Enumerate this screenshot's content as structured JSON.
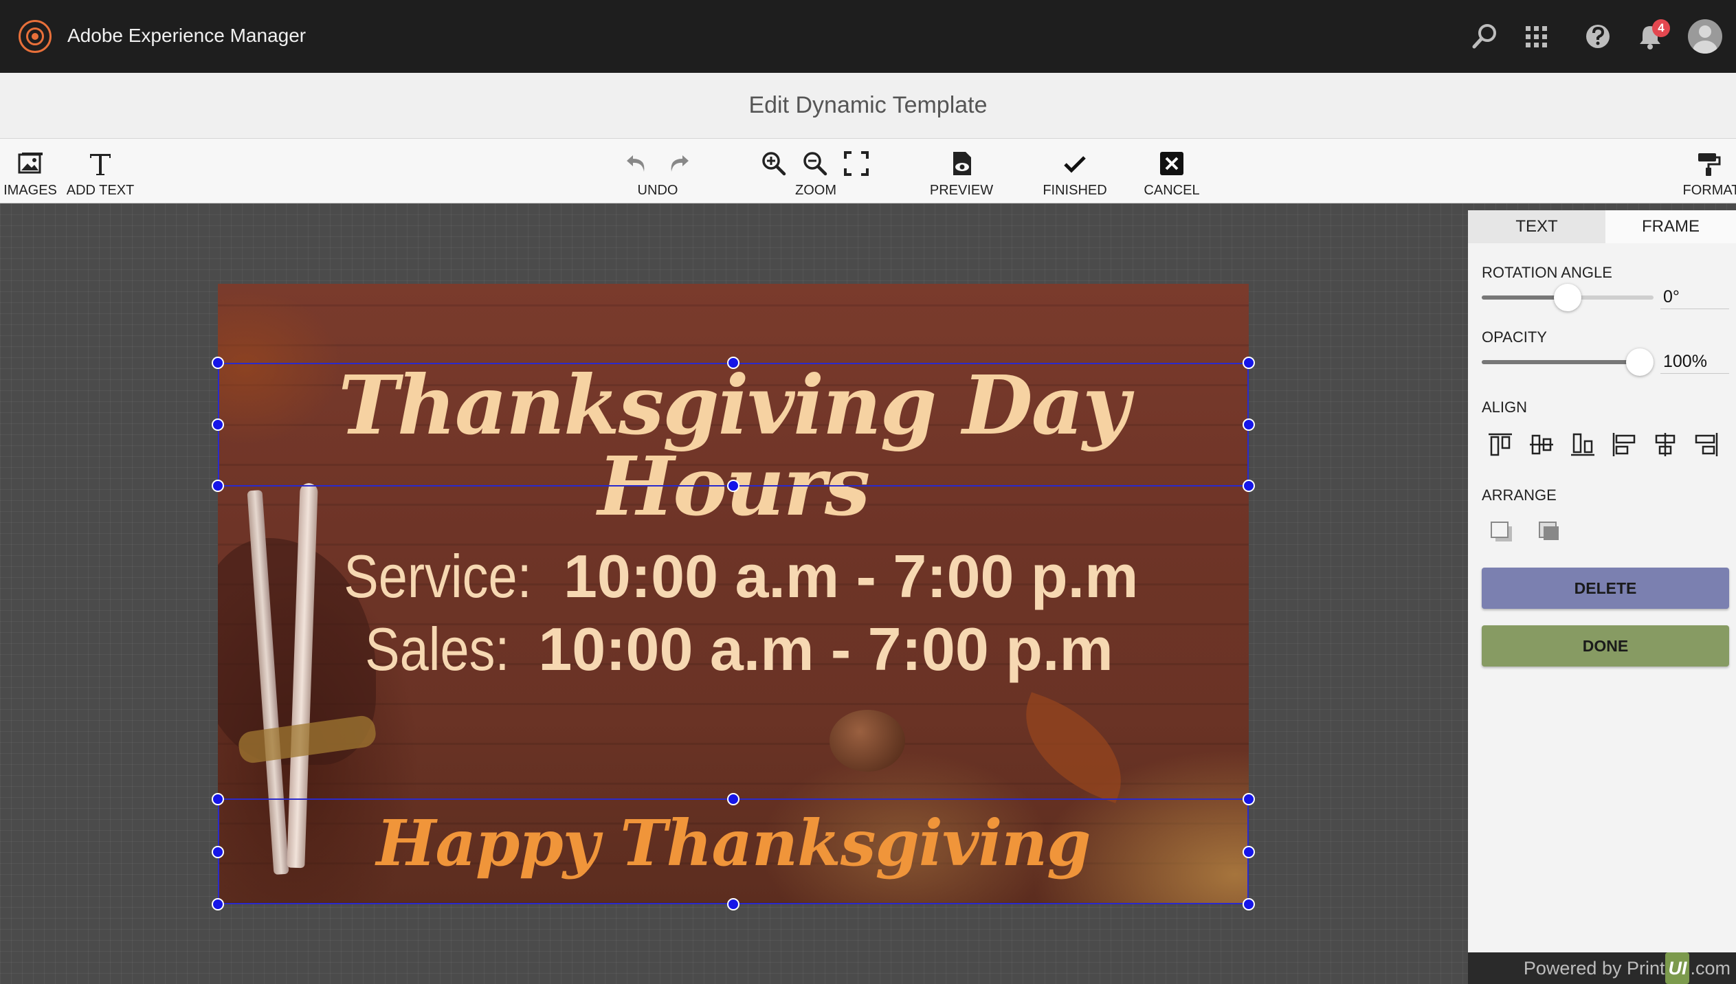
{
  "app": {
    "title": "Adobe Experience Manager",
    "notification_count": "4"
  },
  "page": {
    "title": "Edit Dynamic Template"
  },
  "toolbar": {
    "images": "IMAGES",
    "add_text": "ADD TEXT",
    "undo": "UNDO",
    "zoom": "ZOOM",
    "preview": "PREVIEW",
    "finished": "FINISHED",
    "cancel": "CANCEL",
    "format": "FORMAT"
  },
  "template": {
    "heading": "Thanksgiving Day Hours",
    "service_label": "Service:",
    "service_hours": "10:00 a.m - 7:00 p.m",
    "sales_label": "Sales:",
    "sales_hours": "10:00 a.m - 7:00 p.m",
    "footer": "Happy Thanksgiving"
  },
  "panel": {
    "tabs": {
      "text": "TEXT",
      "frame": "FRAME"
    },
    "active_tab": "FRAME",
    "rotation_label": "ROTATION ANGLE",
    "rotation_value": "0°",
    "rotation_fraction": 0.5,
    "opacity_label": "OPACITY",
    "opacity_value": "100%",
    "opacity_fraction": 1.0,
    "align_label": "ALIGN",
    "arrange_label": "ARRANGE",
    "delete_label": "DELETE",
    "done_label": "DONE"
  },
  "footer": {
    "powered_prefix": "Powered by Print",
    "powered_badge": "UI",
    "powered_suffix": ".com"
  },
  "colors": {
    "accent_delete": "#7b80b0",
    "accent_done": "#879b63",
    "selection": "#1515e8",
    "heading_text": "#f6d2a2",
    "footer_text": "#f0953a"
  },
  "icons": [
    "image-icon",
    "text-icon",
    "undo-icon",
    "redo-icon",
    "zoom-in-icon",
    "zoom-out-icon",
    "fit-screen-icon",
    "preview-icon",
    "checkmark-icon",
    "close-box-icon",
    "format-paint-icon",
    "search-icon",
    "apps-grid-icon",
    "help-icon",
    "bell-icon"
  ]
}
